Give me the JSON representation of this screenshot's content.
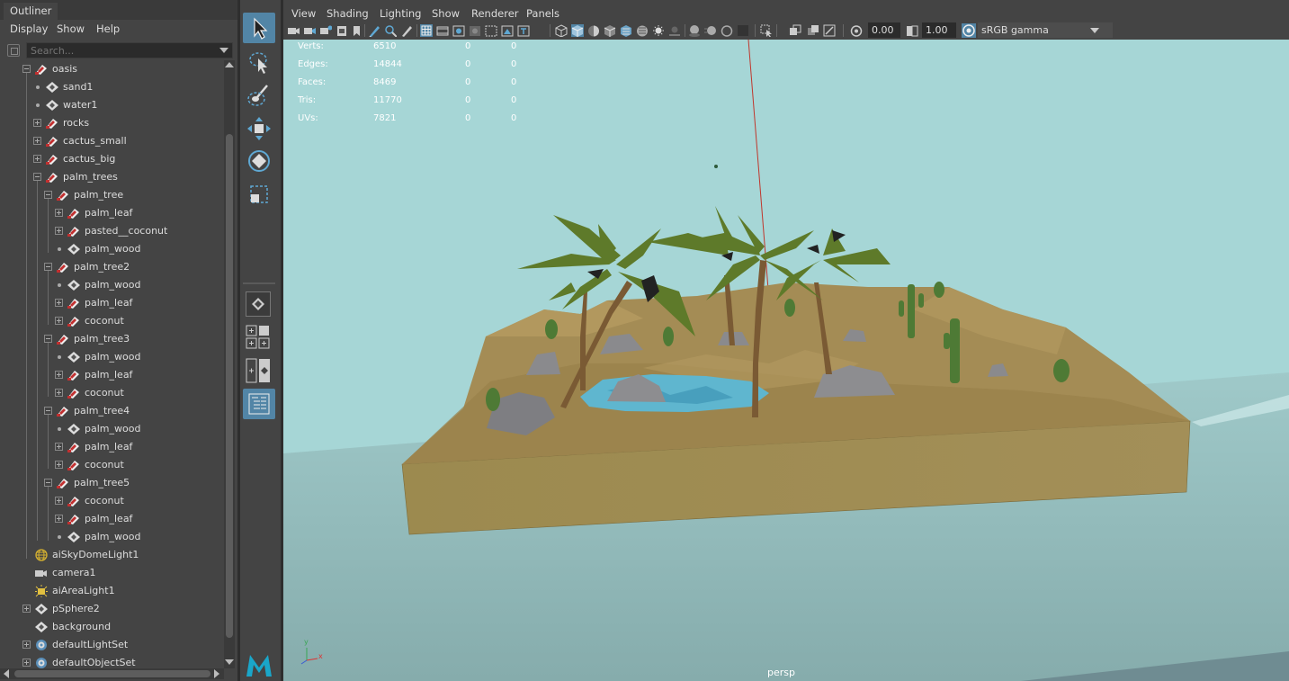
{
  "outliner": {
    "tab": "Outliner",
    "menu": [
      "Display",
      "Show",
      "Help"
    ],
    "search_placeholder": "Search...",
    "items": [
      {
        "label": "oasis",
        "kind": "group",
        "expander": "minus"
      },
      {
        "label": "sand1",
        "kind": "mesh",
        "expander": "dot"
      },
      {
        "label": "water1",
        "kind": "mesh",
        "expander": "dot"
      },
      {
        "label": "rocks",
        "kind": "group",
        "expander": "plus"
      },
      {
        "label": "cactus_small",
        "kind": "group",
        "expander": "plus"
      },
      {
        "label": "cactus_big",
        "kind": "group",
        "expander": "plus"
      },
      {
        "label": "palm_trees",
        "kind": "group",
        "expander": "minus"
      },
      {
        "label": "palm_tree",
        "kind": "group",
        "expander": "minus"
      },
      {
        "label": "palm_leaf",
        "kind": "group",
        "expander": "plus"
      },
      {
        "label": "pasted__coconut",
        "kind": "group",
        "expander": "plus"
      },
      {
        "label": "palm_wood",
        "kind": "mesh",
        "expander": "dot"
      },
      {
        "label": "palm_tree2",
        "kind": "group",
        "expander": "minus"
      },
      {
        "label": "palm_wood",
        "kind": "mesh",
        "expander": "dot"
      },
      {
        "label": "palm_leaf",
        "kind": "group",
        "expander": "plus"
      },
      {
        "label": "coconut",
        "kind": "group",
        "expander": "plus"
      },
      {
        "label": "palm_tree3",
        "kind": "group",
        "expander": "minus"
      },
      {
        "label": "palm_wood",
        "kind": "mesh",
        "expander": "dot"
      },
      {
        "label": "palm_leaf",
        "kind": "group",
        "expander": "plus"
      },
      {
        "label": "coconut",
        "kind": "group",
        "expander": "plus"
      },
      {
        "label": "palm_tree4",
        "kind": "group",
        "expander": "minus"
      },
      {
        "label": "palm_wood",
        "kind": "mesh",
        "expander": "dot"
      },
      {
        "label": "palm_leaf",
        "kind": "group",
        "expander": "plus"
      },
      {
        "label": "coconut",
        "kind": "group",
        "expander": "plus"
      },
      {
        "label": "palm_tree5",
        "kind": "group",
        "expander": "minus"
      },
      {
        "label": "coconut",
        "kind": "group",
        "expander": "plus"
      },
      {
        "label": "palm_leaf",
        "kind": "group",
        "expander": "plus"
      },
      {
        "label": "palm_wood",
        "kind": "mesh",
        "expander": "dot"
      },
      {
        "label": "aiSkyDomeLight1",
        "kind": "skydome",
        "expander": "none"
      },
      {
        "label": "camera1",
        "kind": "camera",
        "expander": "none"
      },
      {
        "label": "aiAreaLight1",
        "kind": "arealight",
        "expander": "none"
      },
      {
        "label": "pSphere2",
        "kind": "mesh",
        "expander": "plus"
      },
      {
        "label": "background",
        "kind": "mesh",
        "expander": "none"
      },
      {
        "label": "defaultLightSet",
        "kind": "set",
        "expander": "plus"
      },
      {
        "label": "defaultObjectSet",
        "kind": "set",
        "expander": "plus"
      }
    ]
  },
  "viewport": {
    "menu": [
      "View",
      "Shading",
      "Lighting",
      "Show",
      "Renderer",
      "Panels"
    ],
    "exposure": "0.00",
    "gamma": "1.00",
    "color_management": "sRGB gamma",
    "camera": "persp",
    "axis_y": "y",
    "axis_x": "x",
    "hud": [
      {
        "label": "Verts:",
        "values": [
          "6510",
          "0",
          "0"
        ]
      },
      {
        "label": "Edges:",
        "values": [
          "14844",
          "0",
          "0"
        ]
      },
      {
        "label": "Faces:",
        "values": [
          "8469",
          "0",
          "0"
        ]
      },
      {
        "label": "Tris:",
        "values": [
          "11770",
          "0",
          "0"
        ]
      },
      {
        "label": "UVs:",
        "values": [
          "7821",
          "0",
          "0"
        ]
      }
    ]
  },
  "colors": {
    "accent": "#5285a6",
    "sky": "#a6d6d6",
    "ground": "#8fb3b3",
    "sand": "#a08c55",
    "water": "#5fb6cf",
    "foliage": "#5e7a2a"
  }
}
